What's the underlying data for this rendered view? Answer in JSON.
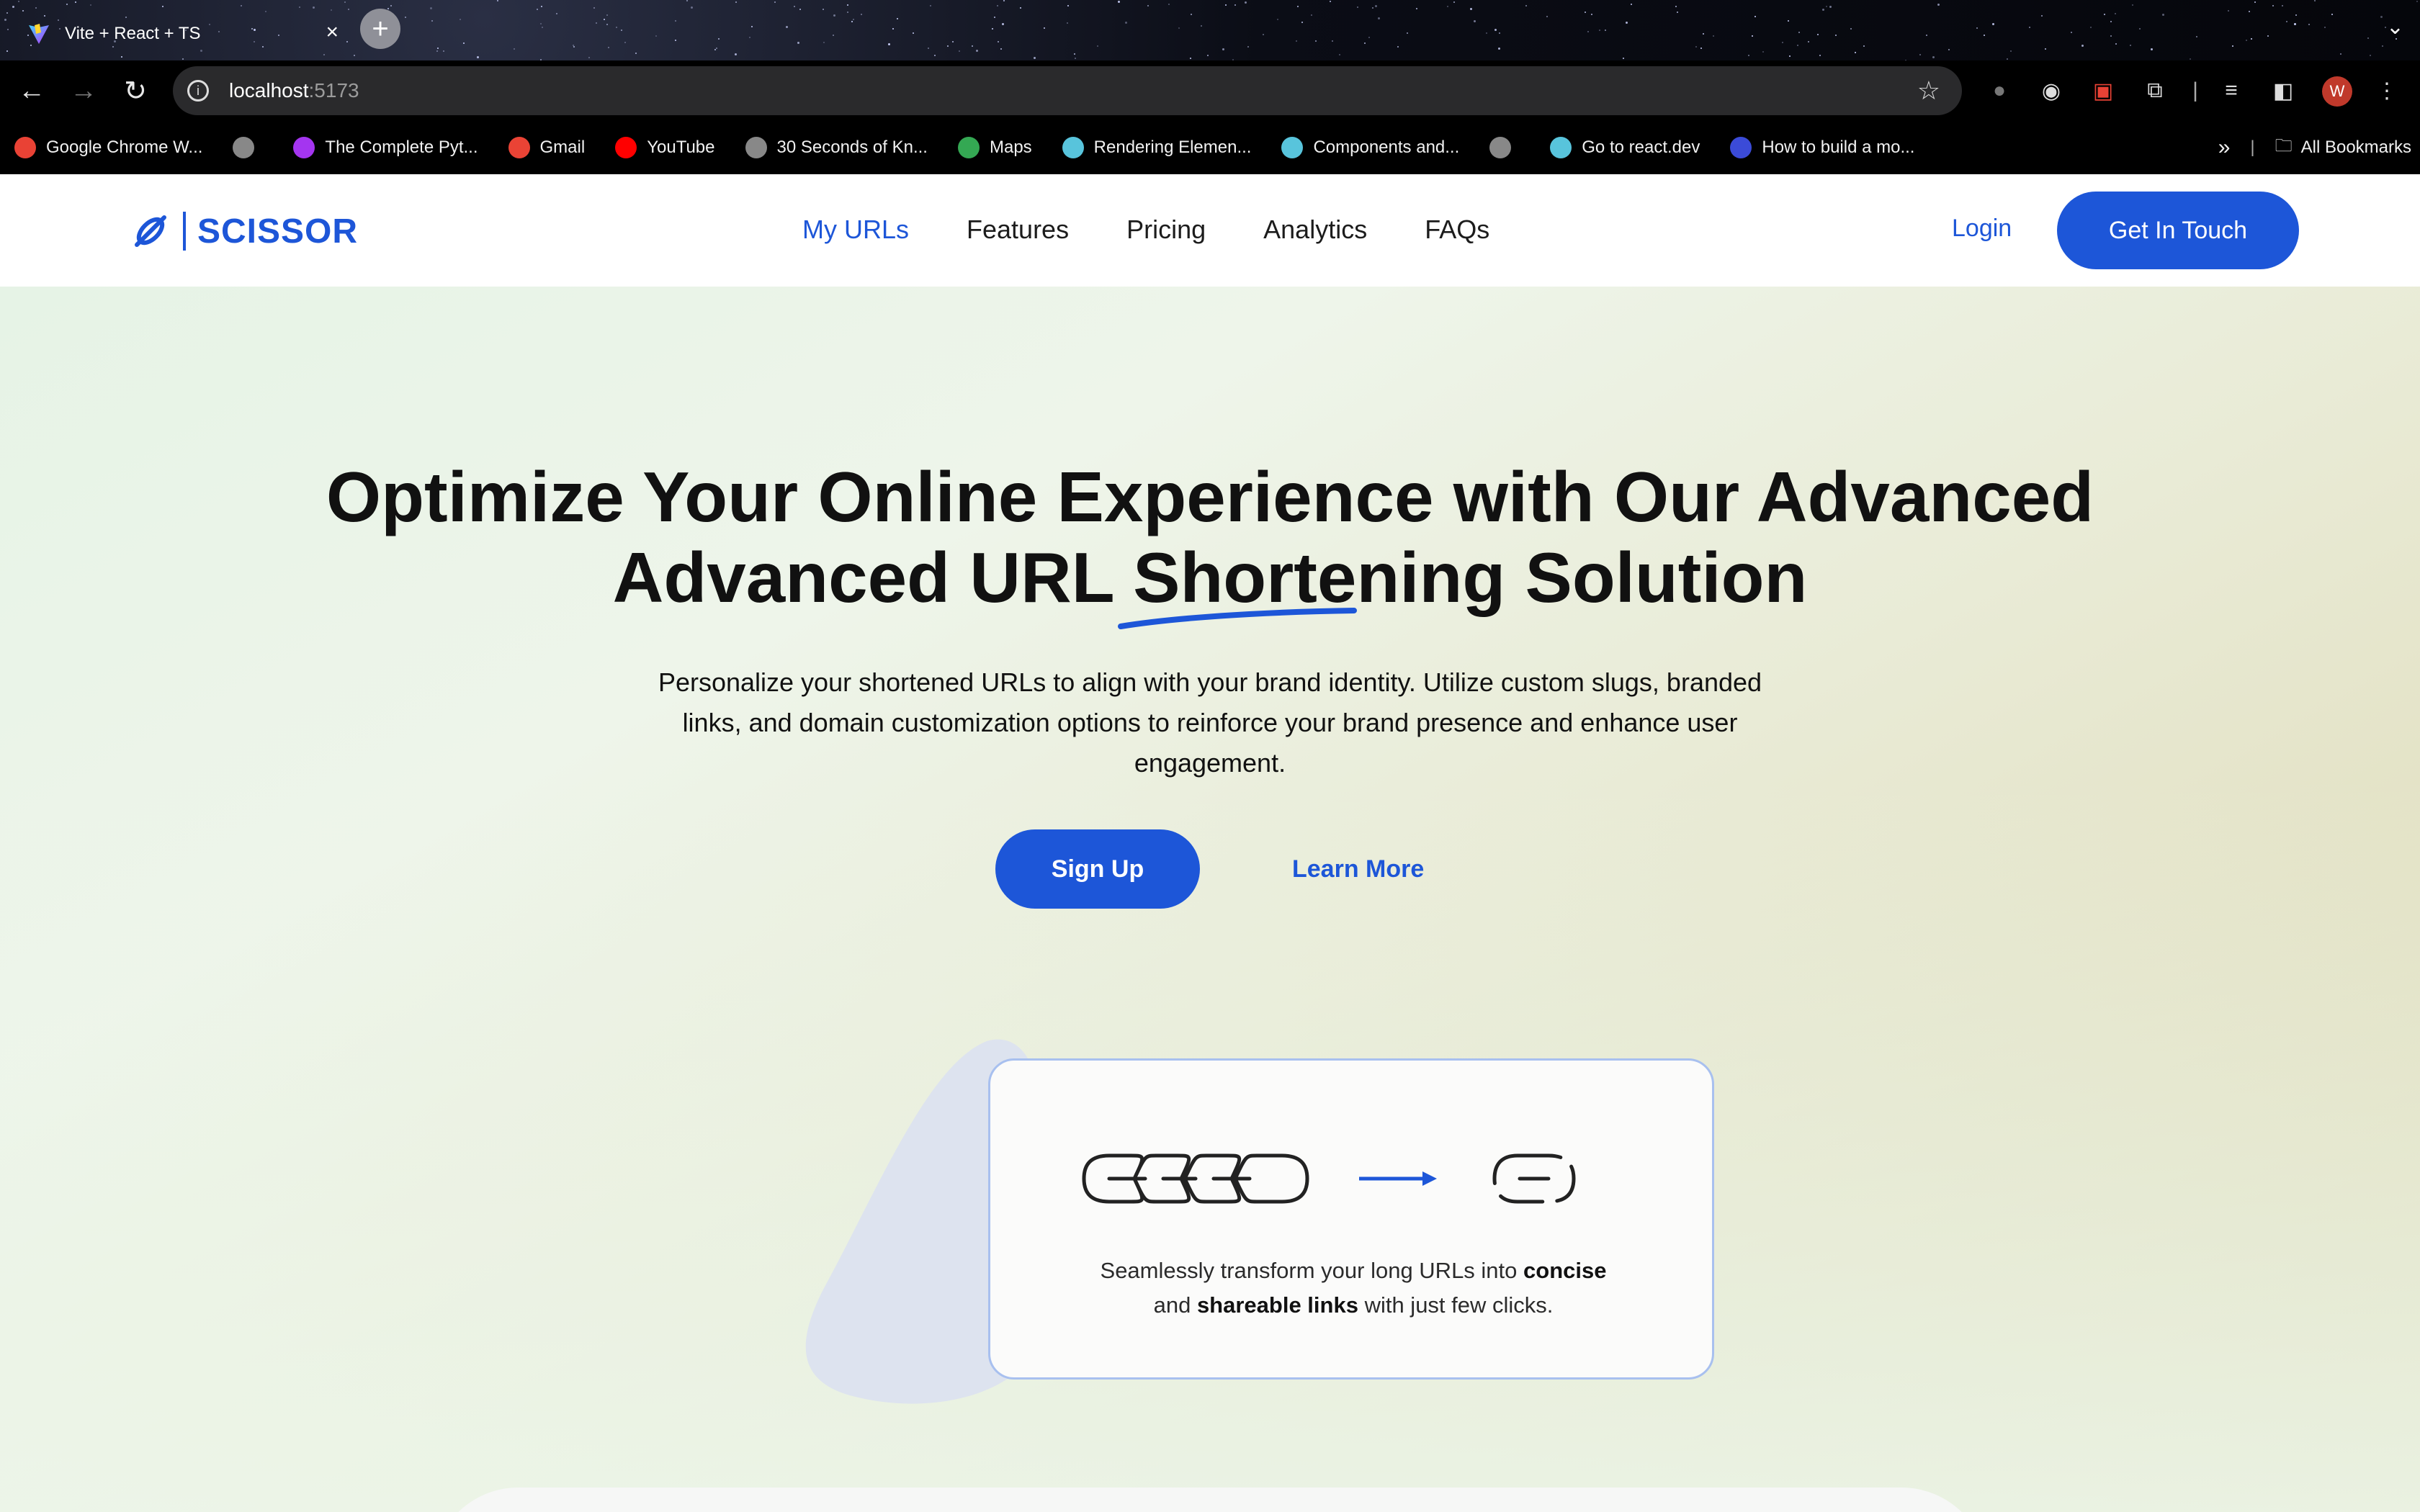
{
  "browser": {
    "tab_title": "Vite + React + TS",
    "tab_close": "×",
    "new_tab": "+",
    "url_host": "localhost",
    "url_port": ":5173",
    "profile_initial": "W",
    "bookmarks": [
      {
        "label": "Google Chrome W...",
        "icon": "chrome-icon",
        "color": "#e94235"
      },
      {
        "label": "",
        "icon": "globe-icon",
        "color": "#888888"
      },
      {
        "label": "The Complete Pyt...",
        "icon": "udemy-icon",
        "color": "#a435f0"
      },
      {
        "label": "Gmail",
        "icon": "gmail-icon",
        "color": "#ea4335"
      },
      {
        "label": "YouTube",
        "icon": "youtube-icon",
        "color": "#ff0000"
      },
      {
        "label": "30 Seconds of Kn...",
        "icon": "globe-icon",
        "color": "#888888"
      },
      {
        "label": "Maps",
        "icon": "maps-icon",
        "color": "#34a853"
      },
      {
        "label": "Rendering Elemen...",
        "icon": "react-icon",
        "color": "#58c4dc"
      },
      {
        "label": "Components and...",
        "icon": "react-icon",
        "color": "#58c4dc"
      },
      {
        "label": "",
        "icon": "globe-icon",
        "color": "#888888"
      },
      {
        "label": "Go to react.dev",
        "icon": "react-icon",
        "color": "#58c4dc"
      },
      {
        "label": "How to build a mo...",
        "icon": "astro-icon",
        "color": "#3b4bd8"
      }
    ],
    "all_bookmarks": "All Bookmarks"
  },
  "header": {
    "logo_text": "SCISSOR",
    "nav": [
      {
        "label": "My URLs",
        "active": true
      },
      {
        "label": "Features",
        "active": false
      },
      {
        "label": "Pricing",
        "active": false
      },
      {
        "label": "Analytics",
        "active": false
      },
      {
        "label": "FAQs",
        "active": false
      }
    ],
    "login": "Login",
    "cta": "Get In Touch"
  },
  "hero": {
    "title_line1": "Optimize Your Online Experience with Our Advanced",
    "title_line2": "Advanced URL Shortening Solution",
    "subtitle": "Personalize your shortened URLs to align with your brand identity. Utilize custom slugs, branded links, and domain customization options to reinforce your brand presence and enhance user engagement.",
    "primary_button": "Sign Up",
    "secondary_button": "Learn More"
  },
  "card": {
    "text_before": "Seamlessly transform your long URLs into ",
    "bold1": "concise",
    "text_mid": " and ",
    "bold2": "shareable links",
    "text_after": " with just few clicks."
  },
  "colors": {
    "brand": "#1d56d8",
    "text": "#111111"
  }
}
